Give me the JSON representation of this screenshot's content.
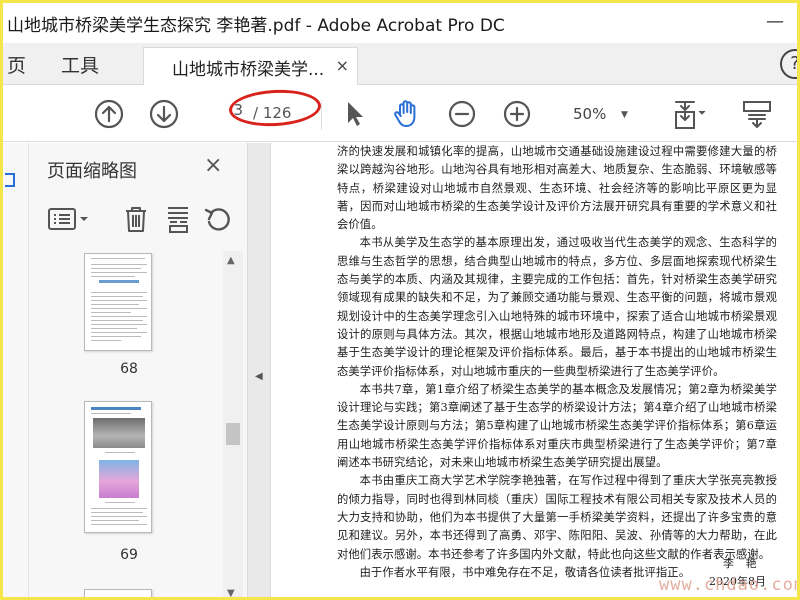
{
  "window": {
    "title": "山地城市桥梁美学生态探究 李艳著.pdf - Adobe Acrobat Pro DC",
    "minimize_glyph": "—"
  },
  "tabs": {
    "home": "页",
    "tools": "工具",
    "document": "山地城市桥梁美学...",
    "close_glyph": "×",
    "help_glyph": "?"
  },
  "toolbar": {
    "page_current": "3",
    "page_total": "/ 126",
    "zoom": "50%",
    "icons": [
      "prev-page-icon",
      "next-page-icon",
      "select-arrow-icon",
      "hand-icon",
      "zoom-out-icon",
      "zoom-in-icon",
      "fit-page-icon",
      "scroll-mode-icon"
    ],
    "accent": "#2a6fd6",
    "annotation_color": "#d8231c"
  },
  "panel": {
    "title": "页面缩略图",
    "close_glyph": "×",
    "tools": [
      "page-options-icon",
      "delete-icon",
      "extract-icon",
      "rotate-icon"
    ],
    "thumbnails": [
      {
        "page": "68"
      },
      {
        "page": "69"
      }
    ]
  },
  "document": {
    "paragraphs": [
      {
        "indent": false,
        "text": "济的快速发展和城镇化率的提高，山地城市交通基础设施建设过程中需要修建大量的桥梁以跨越沟谷地形。山地沟谷具有地形相对高差大、地质复杂、生态脆弱、环境敏感等特点，桥梁建设对山地城市自然景观、生态环境、社会经济等的影响比平原区更为显著，因而对山地城市桥梁的生态美学设计及评价方法展开研究具有重要的学术意义和社会价值。"
      },
      {
        "indent": true,
        "text": "本书从美学及生态学的基本原理出发，通过吸收当代生态美学的观念、生态科学的思维与生态哲学的思想，结合典型山地城市的特点，多方位、多层面地探索现代桥梁生态与美学的本质、内涵及其规律，主要完成的工作包括：首先，针对桥梁生态美学研究领域现有成果的缺失和不足，为了兼顾交通功能与景观、生态平衡的问题，将城市景观规划设计中的生态美学理念引入山地特殊的城市环境中，探索了适合山地城市桥梁景观设计的原则与具体方法。其次，根据山地城市地形及道路网特点，构建了山地城市桥梁基于生态美学设计的理论框架及评价指标体系。最后，基于本书提出的山地城市桥梁生态美学评价指标体系，对山地城市重庆的一些典型桥梁进行了生态美学评价。"
      },
      {
        "indent": true,
        "text": "本书共7章，第1章介绍了桥梁生态美学的基本概念及发展情况；第2章为桥梁美学设计理论与实践；第3章阐述了基于生态学的桥梁设计方法；第4章介绍了山地城市桥梁生态美学设计原则与方法；第5章构建了山地城市桥梁生态美学评价指标体系；第6章运用山地城市桥梁生态美学评价指标体系对重庆市典型桥梁进行了生态美学评价；第7章阐述本书研究结论，对未来山地城市桥梁生态美学研究提出展望。"
      },
      {
        "indent": true,
        "text": "本书由重庆工商大学艺术学院李艳独著，在写作过程中得到了重庆大学张亮亮教授的倾力指导，同时也得到林同棪（重庆）国际工程技术有限公司相关专家及技术人员的大力支持和协助，他们为本书提供了大量第一手桥梁美学资料，还提出了许多宝贵的意见和建议。另外，本书还得到了高勇、邓宇、陈阳阳、吴波、孙倩等的大力帮助，在此对他们表示感谢。本书还参考了许多国内外文献，特此也向这些文献的作者表示感谢。"
      },
      {
        "indent": true,
        "text": "由于作者水平有限，书中难免存在不足，敬请各位读者批评指正。"
      }
    ],
    "signature_name": "李 艳",
    "signature_date": "2020年8月",
    "watermark": "www.chdao.com"
  }
}
